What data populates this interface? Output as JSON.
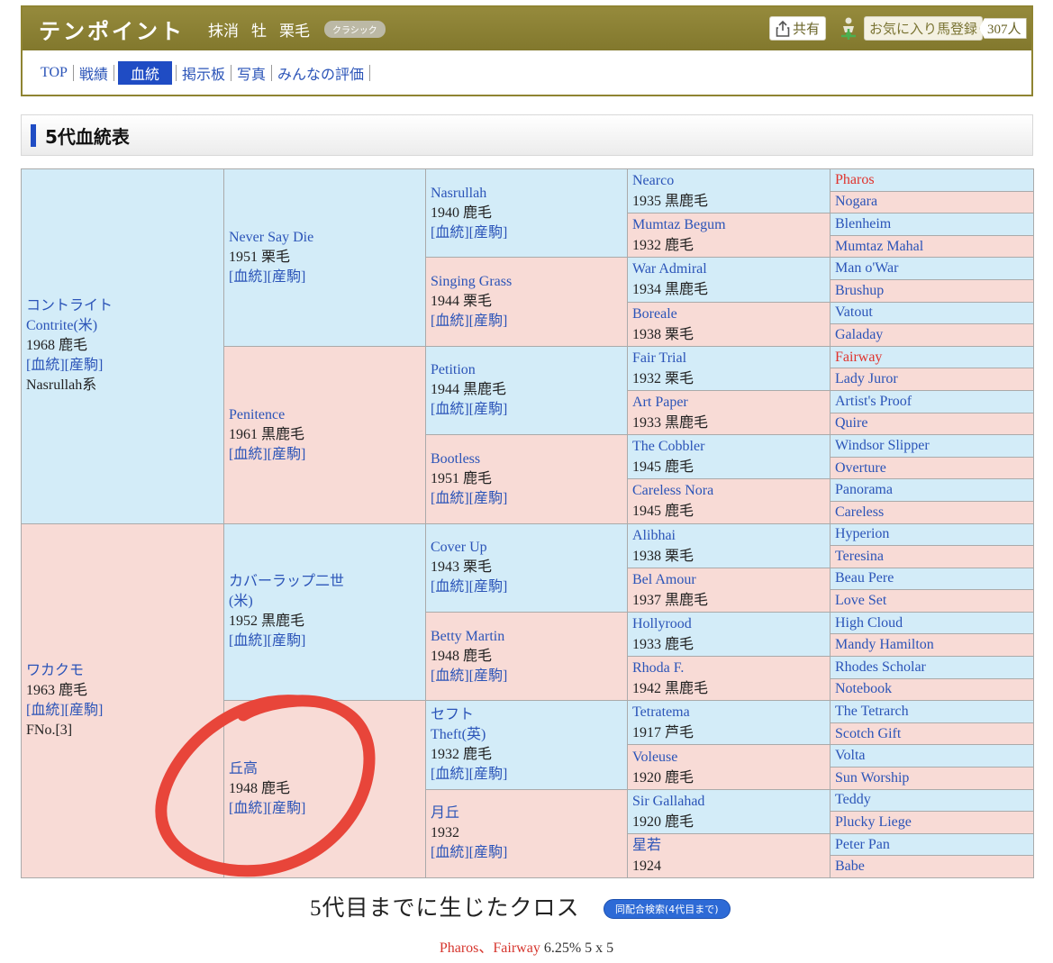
{
  "header": {
    "horse_name": "テンポイント",
    "status": "抹消",
    "sex": "牡",
    "coat": "栗毛",
    "class_badge": "クラシック",
    "share_label": "共有",
    "favorite_label": "お気に入り馬登録",
    "favorite_count": "307人"
  },
  "nav": {
    "items": [
      {
        "label": "TOP",
        "active": false
      },
      {
        "label": "戦績",
        "active": false
      },
      {
        "label": "血統",
        "active": true
      },
      {
        "label": "掲示板",
        "active": false
      },
      {
        "label": "写真",
        "active": false
      },
      {
        "label": "みんなの評価",
        "active": false
      }
    ]
  },
  "section": {
    "title": "5代血統表"
  },
  "links": {
    "pedigree": "[血統]",
    "produce": "[産駒]"
  },
  "pedigree": {
    "g1": [
      {
        "name": "コントライト",
        "name2": "Contrite(米)",
        "year": "1968 鹿毛",
        "extra": "Nasrullah系",
        "sex": "m"
      },
      {
        "name": "ワカクモ",
        "year": "1963 鹿毛",
        "extra": "FNo.[3]",
        "sex": "f"
      }
    ],
    "g2": [
      {
        "name": "Never Say Die",
        "year": "1951 栗毛",
        "sex": "m"
      },
      {
        "name": "Penitence",
        "year": "1961 黒鹿毛",
        "sex": "f"
      },
      {
        "name": "カバーラップ二世",
        "name2": "(米)",
        "year": "1952 黒鹿毛",
        "sex": "m"
      },
      {
        "name": "丘高",
        "year": "1948 鹿毛",
        "sex": "f"
      }
    ],
    "g3": [
      {
        "name": "Nasrullah",
        "year": "1940 鹿毛",
        "sex": "m"
      },
      {
        "name": "Singing Grass",
        "year": "1944 栗毛",
        "sex": "f"
      },
      {
        "name": "Petition",
        "year": "1944 黒鹿毛",
        "sex": "m"
      },
      {
        "name": "Bootless",
        "year": "1951 鹿毛",
        "sex": "f"
      },
      {
        "name": "Cover Up",
        "year": "1943 栗毛",
        "sex": "m"
      },
      {
        "name": "Betty Martin",
        "year": "1948 鹿毛",
        "sex": "f"
      },
      {
        "name": "セフト",
        "name2": "Theft(英)",
        "year": "1932 鹿毛",
        "sex": "m"
      },
      {
        "name": "月丘",
        "year": "1932",
        "sex": "f"
      }
    ],
    "g4": [
      {
        "name": "Nearco",
        "year": "1935 黒鹿毛",
        "sex": "m"
      },
      {
        "name": "Mumtaz Begum",
        "year": "1932 鹿毛",
        "sex": "f"
      },
      {
        "name": "War Admiral",
        "year": "1934 黒鹿毛",
        "sex": "m"
      },
      {
        "name": "Boreale",
        "year": "1938 栗毛",
        "sex": "f"
      },
      {
        "name": "Fair Trial",
        "year": "1932 栗毛",
        "sex": "m"
      },
      {
        "name": "Art Paper",
        "year": "1933 黒鹿毛",
        "sex": "f"
      },
      {
        "name": "The Cobbler",
        "year": "1945 鹿毛",
        "sex": "m"
      },
      {
        "name": "Careless Nora",
        "year": "1945 鹿毛",
        "sex": "f"
      },
      {
        "name": "Alibhai",
        "year": "1938 栗毛",
        "sex": "m"
      },
      {
        "name": "Bel Amour",
        "year": "1937 黒鹿毛",
        "sex": "f"
      },
      {
        "name": "Hollyrood",
        "year": "1933 鹿毛",
        "sex": "m"
      },
      {
        "name": "Rhoda F.",
        "year": "1942 黒鹿毛",
        "sex": "f"
      },
      {
        "name": "Tetratema",
        "year": "1917 芦毛",
        "sex": "m"
      },
      {
        "name": "Voleuse",
        "year": "1920 鹿毛",
        "sex": "f"
      },
      {
        "name": "Sir Gallahad",
        "year": "1920 鹿毛",
        "sex": "m"
      },
      {
        "name": "星若",
        "year": "1924",
        "sex": "f"
      }
    ],
    "g5": [
      {
        "name": "Pharos",
        "sex": "m",
        "cross": true
      },
      {
        "name": "Nogara",
        "sex": "f"
      },
      {
        "name": "Blenheim",
        "sex": "m"
      },
      {
        "name": "Mumtaz Mahal",
        "sex": "f"
      },
      {
        "name": "Man o'War",
        "sex": "m"
      },
      {
        "name": "Brushup",
        "sex": "f"
      },
      {
        "name": "Vatout",
        "sex": "m"
      },
      {
        "name": "Galaday",
        "sex": "f"
      },
      {
        "name": "Fairway",
        "sex": "m",
        "cross": true
      },
      {
        "name": "Lady Juror",
        "sex": "f"
      },
      {
        "name": "Artist's Proof",
        "sex": "m"
      },
      {
        "name": "Quire",
        "sex": "f"
      },
      {
        "name": "Windsor Slipper",
        "sex": "m"
      },
      {
        "name": "Overture",
        "sex": "f"
      },
      {
        "name": "Panorama",
        "sex": "m"
      },
      {
        "name": "Careless",
        "sex": "f"
      },
      {
        "name": "Hyperion",
        "sex": "m"
      },
      {
        "name": "Teresina",
        "sex": "f"
      },
      {
        "name": "Beau Pere",
        "sex": "m"
      },
      {
        "name": "Love Set",
        "sex": "f"
      },
      {
        "name": "High Cloud",
        "sex": "m"
      },
      {
        "name": "Mandy Hamilton",
        "sex": "f"
      },
      {
        "name": "Rhodes Scholar",
        "sex": "m"
      },
      {
        "name": "Notebook",
        "sex": "f"
      },
      {
        "name": "The Tetrarch",
        "sex": "m"
      },
      {
        "name": "Scotch Gift",
        "sex": "f"
      },
      {
        "name": "Volta",
        "sex": "m"
      },
      {
        "name": "Sun Worship",
        "sex": "f"
      },
      {
        "name": "Teddy",
        "sex": "m"
      },
      {
        "name": "Plucky Liege",
        "sex": "f"
      },
      {
        "name": "Peter Pan",
        "sex": "m"
      },
      {
        "name": "Babe",
        "sex": "f"
      }
    ]
  },
  "cross": {
    "title": "5代目までに生じたクロス",
    "search_button": "同配合検索(4代目まで)",
    "names": "Pharos、Fairway",
    "detail": " 6.25%  5 x 5"
  },
  "colors": {
    "accent": "#1f4cc4",
    "header_bg": "#8f8432",
    "male_bg": "#d3ecf8",
    "female_bg": "#f8dbd6",
    "cross_red": "#e0322c",
    "annotation": "#e8453a"
  }
}
